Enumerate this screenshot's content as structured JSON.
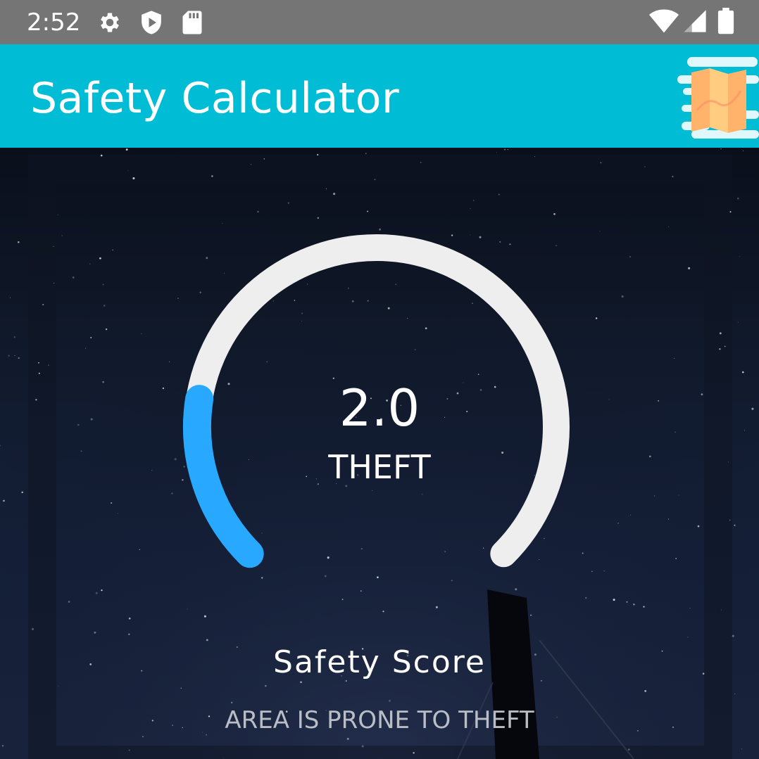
{
  "status_bar": {
    "time": "2:52",
    "icons": [
      "settings-icon",
      "shield-play-icon",
      "sd-card-icon",
      "wifi-icon",
      "cell-signal-icon",
      "battery-icon"
    ]
  },
  "app_bar": {
    "title": "Safety Calculator",
    "background_color": "#00bcd4",
    "map_icon": "map-icon"
  },
  "gauge": {
    "value": "2.0",
    "category": "THEFT",
    "fill_fraction": 0.2,
    "fill_color": "#29a8ff",
    "track_color": "#eeeeee"
  },
  "summary": {
    "title": "Safety Score",
    "message": "AREA IS PRONE TO THEFT"
  }
}
